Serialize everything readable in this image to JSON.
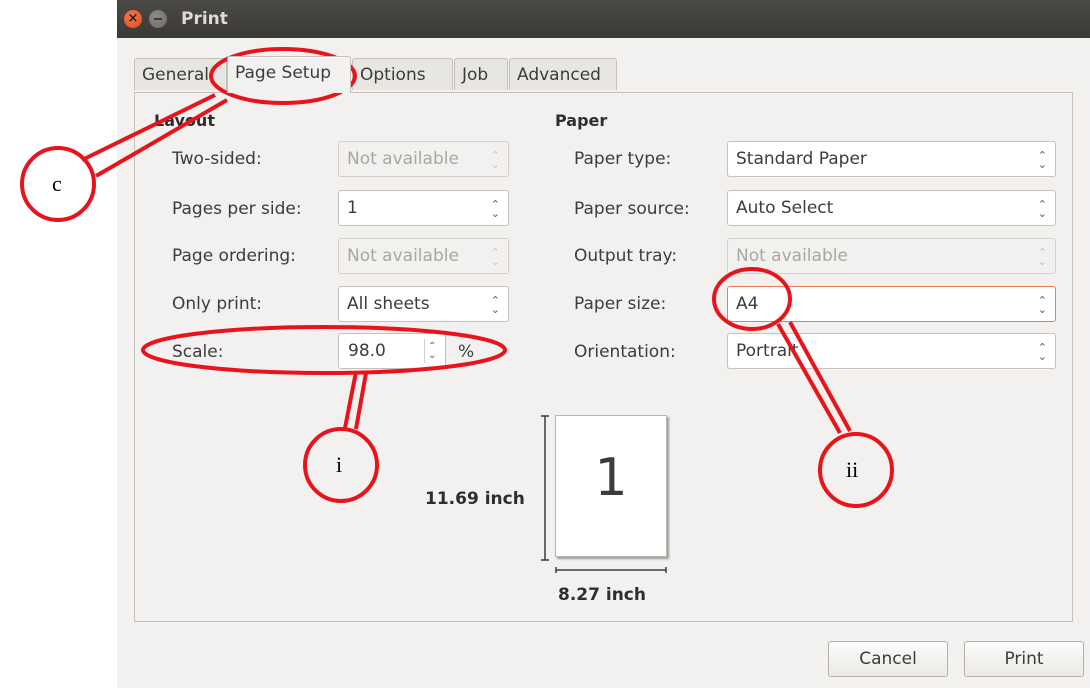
{
  "window": {
    "title": "Print"
  },
  "tabs": [
    {
      "label": "General"
    },
    {
      "label": "Page Setup"
    },
    {
      "label": "Options"
    },
    {
      "label": "Job"
    },
    {
      "label": "Advanced"
    }
  ],
  "layout": {
    "heading": "Layout",
    "two_sided": {
      "label": "Two-sided:",
      "value": "Not available"
    },
    "pages_per_side": {
      "label": "Pages per side:",
      "value": "1"
    },
    "page_ordering": {
      "label": "Page ordering:",
      "value": "Not available"
    },
    "only_print": {
      "label": "Only print:",
      "value": "All sheets"
    },
    "scale": {
      "label": "Scale:",
      "value": "98.0",
      "unit": "%"
    }
  },
  "paper": {
    "heading": "Paper",
    "paper_type": {
      "label": "Paper type:",
      "value": "Standard Paper"
    },
    "paper_source": {
      "label": "Paper source:",
      "value": "Auto Select"
    },
    "output_tray": {
      "label": "Output tray:",
      "value": "Not available"
    },
    "paper_size": {
      "label": "Paper size:",
      "value": "A4"
    },
    "orientation": {
      "label": "Orientation:",
      "value": "Portrait"
    }
  },
  "preview": {
    "page_number": "1",
    "height_label": "11.69 inch",
    "width_label": "8.27 inch"
  },
  "buttons": {
    "cancel": "Cancel",
    "print": "Print"
  },
  "annotations": {
    "c": "c",
    "i": "i",
    "ii": "ii",
    "color": "#e8141b"
  },
  "icons": {
    "close": "close-icon",
    "minimize": "minimize-icon",
    "spinner": "up-down-arrows-icon"
  }
}
